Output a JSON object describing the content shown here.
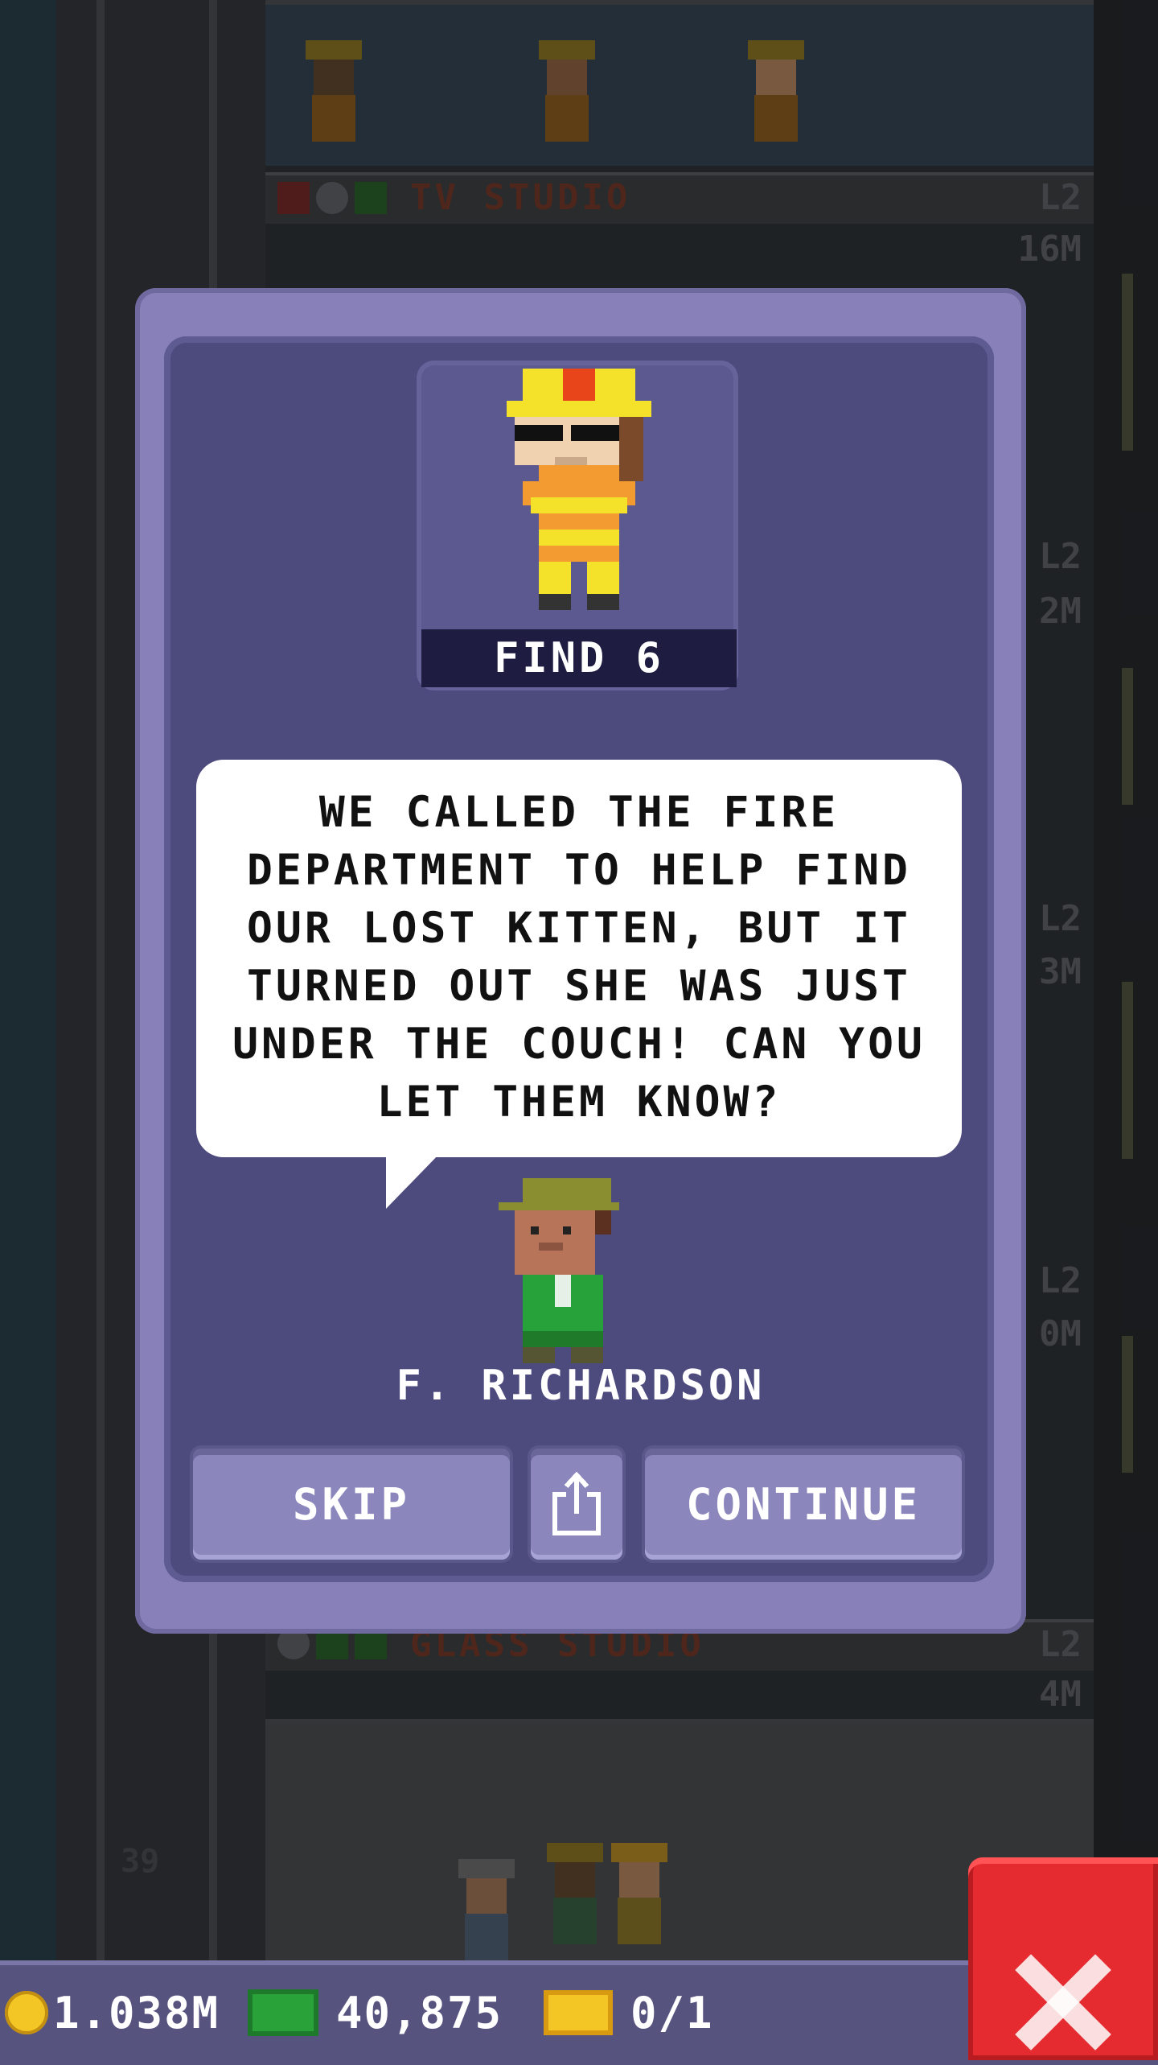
{
  "mission": {
    "target_label": "FIND 6",
    "message": "We called the fire department to help find our lost kitten, but it turned out she was just under the couch! Can you let them know?",
    "sender_name": "F. RICHARDSON"
  },
  "buttons": {
    "skip_label": "SKIP",
    "share_icon": "share-icon",
    "continue_label": "CONTINUE"
  },
  "background_floors": {
    "top_floor": {
      "name": "TV STUDIO",
      "level": "L2",
      "income": "16M"
    },
    "bottom_floor": {
      "name": "GLASS STUDIO",
      "level": "L2",
      "income": "4M"
    },
    "side_levels": [
      "L2",
      "2M",
      "L2",
      "3M",
      "L2",
      "0M",
      "L2"
    ],
    "floor_number": "39"
  },
  "status_bar": {
    "coins": "1.038M",
    "bux": "40,875",
    "tickets": "0/1"
  },
  "colors": {
    "dialog_frame": "#8880b8",
    "dialog_panel": "#4d4a7e",
    "button": "#8b87bc",
    "close_button": "#e52b2f",
    "coin": "#f3c626",
    "bux": "#2aa23a"
  }
}
